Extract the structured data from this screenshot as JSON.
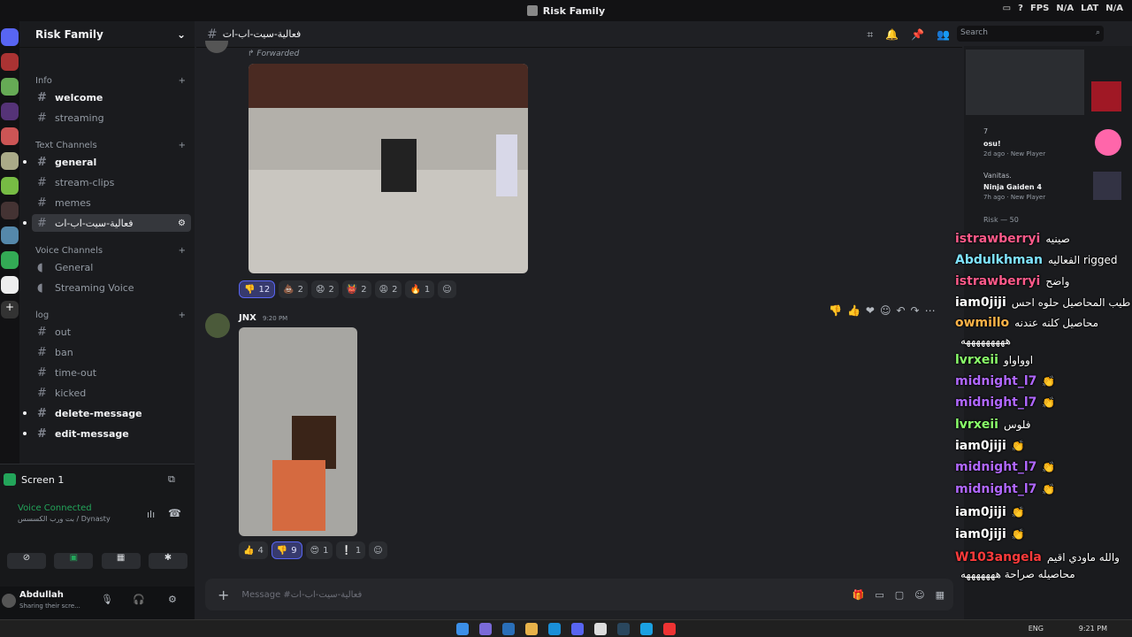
{
  "window": {
    "title": "Risk Family",
    "fps": "FPS",
    "fps_val": "N/A",
    "lat": "LAT",
    "lat_val": "N/A"
  },
  "server": {
    "name": "Risk Family"
  },
  "categories": {
    "info": "Info",
    "text": "Text Channels",
    "voice": "Voice Channels",
    "log": "log"
  },
  "channels": {
    "welcome": "welcome",
    "streaming": "streaming",
    "general": "general",
    "stream_clips": "stream-clips",
    "memes": "memes",
    "active": "فعالية-سيت-اب-ات",
    "voice_general": "General",
    "streaming_voice": "Streaming Voice",
    "out": "out",
    "ban": "ban",
    "time_out": "time-out",
    "kicked": "kicked",
    "delete_message": "delete-message",
    "edit_message": "edit-message"
  },
  "screen": {
    "label": "Screen 1"
  },
  "voice": {
    "status": "Voice Connected",
    "sub": "بت ورب الكسسس / Dynasty"
  },
  "user": {
    "name": "Abdullah",
    "status": "Sharing their scre..."
  },
  "channel_header": {
    "name": "فعالية-سيت-اب-ات"
  },
  "search": {
    "placeholder": "Search"
  },
  "messages": {
    "forwarded": "Forwarded",
    "author": "JNX",
    "time": "9:20 PM"
  },
  "reactions1": [
    "12",
    "2",
    "2",
    "2",
    "2",
    "1"
  ],
  "reactions2": [
    "4",
    "9",
    "1",
    "1"
  ],
  "composer": {
    "placeholder": "Message #فعالية-سيت-اب-ات"
  },
  "members": {
    "m1": "7",
    "m1_game": "osu!",
    "m1_meta": "2d ago",
    "m1_tag": "New Player",
    "m2": "Vanitas.",
    "m2_game": "Ninja Gaiden 4",
    "m2_meta": "7h ago",
    "m2_tag": "New Player",
    "section": "Risk — 50"
  },
  "chat": [
    {
      "user": "istrawberryi",
      "msg": "صينيه",
      "color": "#ff5a8a"
    },
    {
      "user": "Abdulkhman",
      "msg": "الفعاليه rigged",
      "color": "#7fe3ff"
    },
    {
      "user": "istrawberryi",
      "msg": "واضح",
      "color": "#ff5a8a"
    },
    {
      "user": "iam0jiji",
      "msg": "طيب المحاصيل حلوه احس",
      "color": "#ffffff"
    },
    {
      "user": "owmillo",
      "msg": "محاصيل كلنه عندنه",
      "color": "#ffb347"
    },
    {
      "user": "",
      "msg": "هههههههههه",
      "color": "#ffffff"
    },
    {
      "user": "lvrxeii",
      "msg": "اوواواو",
      "color": "#8aff6a"
    },
    {
      "user": "midnight_l7",
      "msg": "👏",
      "color": "#b067ff"
    },
    {
      "user": "midnight_l7",
      "msg": "👏",
      "color": "#b067ff"
    },
    {
      "user": "lvrxeii",
      "msg": "فلوس",
      "color": "#8aff6a"
    },
    {
      "user": "iam0jiji",
      "msg": "👏",
      "color": "#ffffff"
    },
    {
      "user": "midnight_l7",
      "msg": "👏",
      "color": "#b067ff"
    },
    {
      "user": "midnight_l7",
      "msg": "👏",
      "color": "#b067ff"
    },
    {
      "user": "iam0jiji",
      "msg": "👏",
      "color": "#ffffff"
    },
    {
      "user": "iam0jiji",
      "msg": "👏",
      "color": "#ffffff"
    },
    {
      "user": "W103angela",
      "msg": "والله ماودي اقيم",
      "color": "#ff3b3b"
    },
    {
      "user": "",
      "msg": "محاصيله صراحة هههههههه",
      "color": "#ffffff"
    }
  ],
  "taskbar": {
    "time": "9:21 PM",
    "lang": "ENG"
  }
}
